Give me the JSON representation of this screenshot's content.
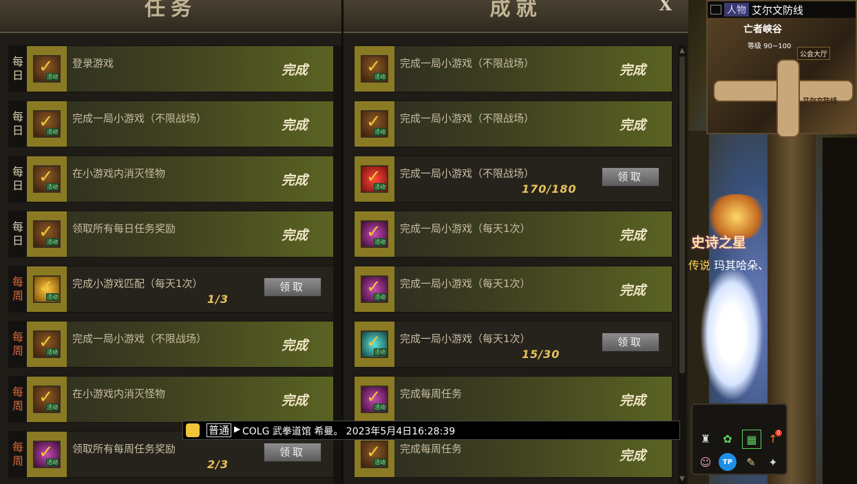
{
  "tasks": {
    "title": "任务",
    "rows": [
      {
        "cat": [
          "每",
          "日"
        ],
        "title": "登录游戏",
        "status": "完成"
      },
      {
        "cat": [
          "每",
          "日"
        ],
        "title": "完成一局小游戏（不限战场）",
        "status": "完成"
      },
      {
        "cat": [
          "每",
          "日"
        ],
        "title": "在小游戏内消灭怪物",
        "status": "完成"
      },
      {
        "cat": [
          "每",
          "日"
        ],
        "title": "领取所有每日任务奖励",
        "status": "完成"
      },
      {
        "cat": [
          "每",
          "周"
        ],
        "title": "完成小游戏匹配（每天1次）",
        "progress": "1/3",
        "claim": "领取"
      },
      {
        "cat": [
          "每",
          "周"
        ],
        "title": "完成一局小游戏（不限战场）",
        "status": "完成"
      },
      {
        "cat": [
          "每",
          "周"
        ],
        "title": "在小游戏内消灭怪物",
        "status": "完成"
      },
      {
        "cat": [
          "每",
          "周"
        ],
        "title": "领取所有每周任务奖励",
        "progress": "2/3",
        "claim": "领取"
      }
    ]
  },
  "achievements": {
    "title": "成就",
    "close": "X",
    "rows": [
      {
        "title": "完成一局小游戏（不限战场）",
        "status": "完成"
      },
      {
        "title": "完成一局小游戏（不限战场）",
        "status": "完成"
      },
      {
        "title": "完成一局小游戏（不限战场）",
        "progress": "170/180",
        "claim": "领取"
      },
      {
        "title": "完成一局小游戏（每天1次）",
        "status": "完成"
      },
      {
        "title": "完成一局小游戏（每天1次）",
        "status": "完成"
      },
      {
        "title": "完成一局小游戏（每天1次）",
        "progress": "15/30",
        "claim": "领取"
      },
      {
        "title": "完成每周任务",
        "status": "完成"
      },
      {
        "title": "完成每周任务",
        "status": "完成"
      }
    ]
  },
  "minimap": {
    "tab": "人物",
    "zone": "艾尔文防线",
    "area": "亡者峡谷",
    "level": "等级 90~100",
    "guild": "公会大厅",
    "area2": "艾尔文防线"
  },
  "character": {
    "title": "史诗之星",
    "prefix": "传说",
    "name": "玛其哈朵、"
  },
  "chat": {
    "channel": "普通",
    "message": "COLG 武拳道馆 希曼。 2023年5月4日16:28:39"
  },
  "hotbar": {
    "badge": "0"
  }
}
